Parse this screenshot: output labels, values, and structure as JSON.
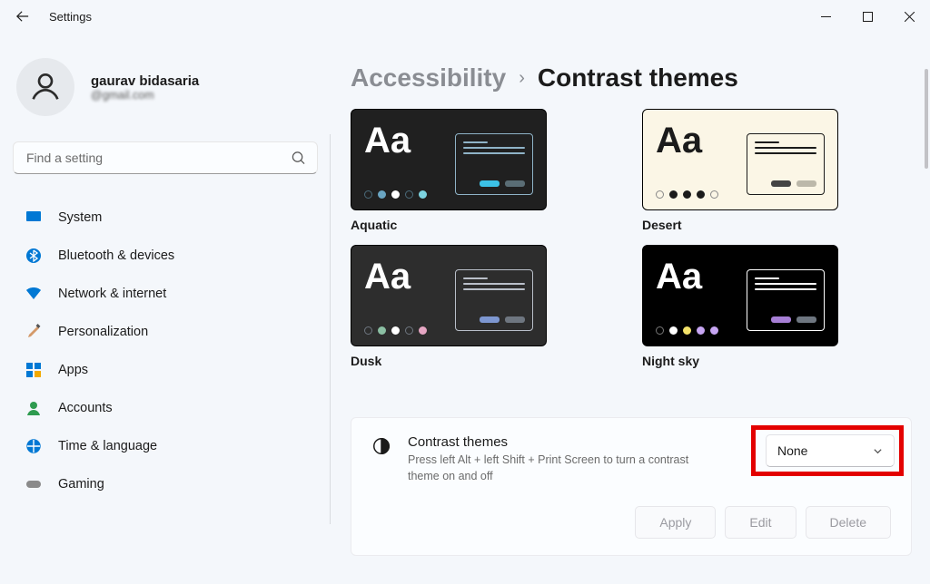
{
  "titlebar": {
    "title": "Settings"
  },
  "profile": {
    "name": "gaurav bidasaria",
    "email": "@gmail.com"
  },
  "search": {
    "placeholder": "Find a setting"
  },
  "nav": {
    "items": [
      {
        "label": "System"
      },
      {
        "label": "Bluetooth & devices"
      },
      {
        "label": "Network & internet"
      },
      {
        "label": "Personalization"
      },
      {
        "label": "Apps"
      },
      {
        "label": "Accounts"
      },
      {
        "label": "Time & language"
      },
      {
        "label": "Gaming"
      }
    ]
  },
  "breadcrumb": {
    "parent": "Accessibility",
    "current": "Contrast themes"
  },
  "previews": [
    {
      "label": "Aquatic",
      "aa": "Aa"
    },
    {
      "label": "Desert",
      "aa": "Aa"
    },
    {
      "label": "Dusk",
      "aa": "Aa"
    },
    {
      "label": "Night sky",
      "aa": "Aa"
    }
  ],
  "card": {
    "title": "Contrast themes",
    "description": "Press left Alt + left Shift + Print Screen to turn a contrast theme on and off",
    "select_value": "None",
    "actions": {
      "apply": "Apply",
      "edit": "Edit",
      "delete": "Delete"
    }
  }
}
